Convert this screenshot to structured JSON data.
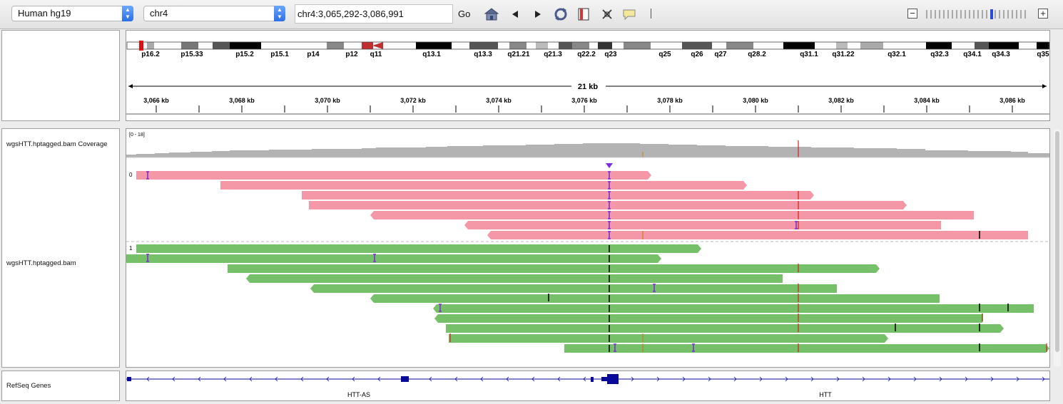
{
  "toolbar": {
    "genome": "Human hg19",
    "chromosome": "chr4",
    "locus": "chr4:3,065,292-3,086,991",
    "go_label": "Go",
    "icons": [
      "home-icon",
      "back-icon",
      "forward-icon",
      "refresh-icon",
      "roi-icon",
      "resize-icon",
      "popup-text-icon",
      "ruler-divider"
    ]
  },
  "ideogram": {
    "bands": [
      "p16.2",
      "p15.33",
      "p15.2",
      "p15.1",
      "p14",
      "p12",
      "q11",
      "q13.1",
      "q13.3",
      "q21.21",
      "q21.3",
      "q22.2",
      "q23",
      "q25",
      "q26",
      "q27",
      "q28.2",
      "q31.1",
      "q31.22",
      "q32.1",
      "q32.3",
      "q34.1",
      "q34.3",
      "q35"
    ]
  },
  "ruler": {
    "span_label": "21 kb",
    "ticks": [
      "3,066 kb",
      "3,068 kb",
      "3,070 kb",
      "3,072 kb",
      "3,074 kb",
      "3,076 kb",
      "3,078 kb",
      "3,080 kb",
      "3,082 kb",
      "3,084 kb",
      "3,086 kb"
    ]
  },
  "tracks": {
    "coverage_name": "wgsHTT.hptagged.bam Coverage",
    "coverage_range": "[0 - 18]",
    "alignment_name": "wgsHTT.hptagged.bam",
    "group_0_label": "0",
    "group_1_label": "1",
    "genes_name": "RefSeq Genes",
    "gene_1": "HTT-AS",
    "gene_2": "HTT"
  },
  "colors": {
    "coverage": "#b3b3b3",
    "haplotype_0": "#f497a6",
    "haplotype_1": "#77c06a",
    "insertion": "#7b2fd6",
    "gene": "#0a0a9a",
    "mismatch": "#d0201a"
  }
}
